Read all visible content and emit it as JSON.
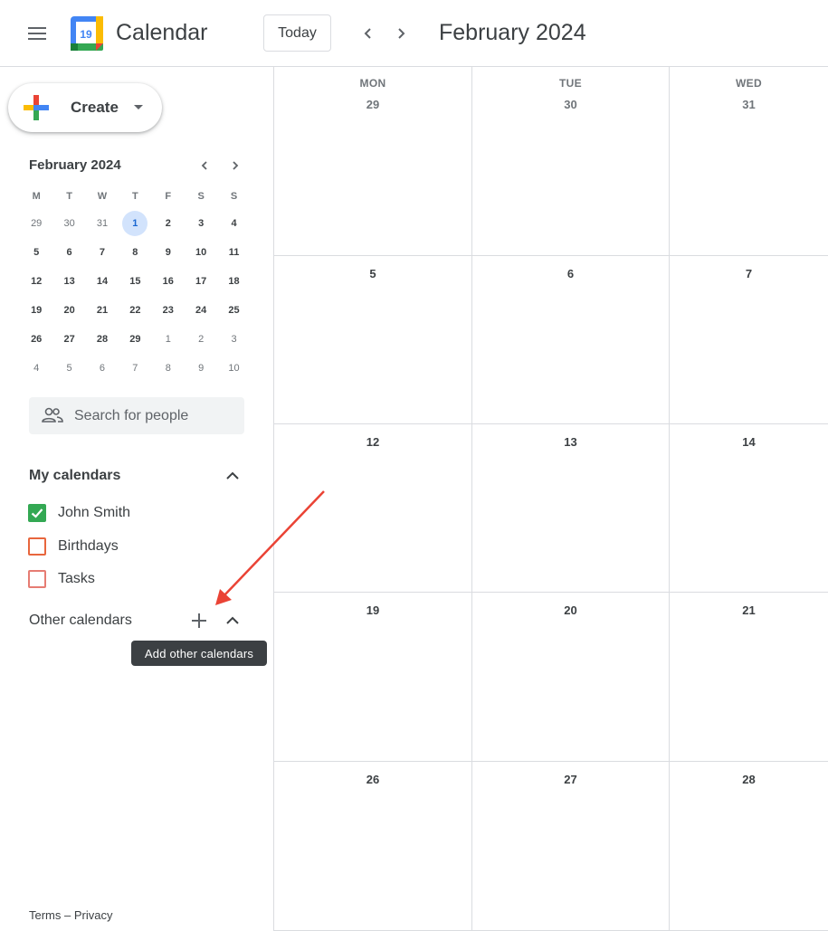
{
  "header": {
    "app_title": "Calendar",
    "logo_day": "19",
    "today_label": "Today",
    "month_title": "February 2024"
  },
  "sidebar": {
    "create_label": "Create",
    "mini_calendar": {
      "title": "February 2024",
      "weekdays": [
        "M",
        "T",
        "W",
        "T",
        "F",
        "S",
        "S"
      ],
      "weeks": [
        [
          {
            "d": "29",
            "other": true
          },
          {
            "d": "30",
            "other": true
          },
          {
            "d": "31",
            "other": true
          },
          {
            "d": "1",
            "today": true
          },
          {
            "d": "2"
          },
          {
            "d": "3"
          },
          {
            "d": "4"
          }
        ],
        [
          {
            "d": "5"
          },
          {
            "d": "6"
          },
          {
            "d": "7"
          },
          {
            "d": "8"
          },
          {
            "d": "9"
          },
          {
            "d": "10"
          },
          {
            "d": "11"
          }
        ],
        [
          {
            "d": "12"
          },
          {
            "d": "13"
          },
          {
            "d": "14"
          },
          {
            "d": "15"
          },
          {
            "d": "16"
          },
          {
            "d": "17"
          },
          {
            "d": "18"
          }
        ],
        [
          {
            "d": "19"
          },
          {
            "d": "20"
          },
          {
            "d": "21"
          },
          {
            "d": "22"
          },
          {
            "d": "23"
          },
          {
            "d": "24"
          },
          {
            "d": "25"
          }
        ],
        [
          {
            "d": "26"
          },
          {
            "d": "27"
          },
          {
            "d": "28"
          },
          {
            "d": "29"
          },
          {
            "d": "1",
            "other": true
          },
          {
            "d": "2",
            "other": true
          },
          {
            "d": "3",
            "other": true
          }
        ],
        [
          {
            "d": "4",
            "other": true
          },
          {
            "d": "5",
            "other": true
          },
          {
            "d": "6",
            "other": true
          },
          {
            "d": "7",
            "other": true
          },
          {
            "d": "8",
            "other": true
          },
          {
            "d": "9",
            "other": true
          },
          {
            "d": "10",
            "other": true
          }
        ]
      ]
    },
    "search_people_placeholder": "Search for people",
    "my_calendars_title": "My calendars",
    "my_calendars": [
      {
        "label": "John Smith",
        "checked": true,
        "color": "#33a853"
      },
      {
        "label": "Birthdays",
        "checked": false,
        "color": "#e8663d"
      },
      {
        "label": "Tasks",
        "checked": false,
        "color": "#e67c73"
      }
    ],
    "other_calendars_title": "Other calendars",
    "tooltip": "Add other calendars",
    "footer": {
      "terms": "Terms",
      "separator": "–",
      "privacy": "Privacy"
    }
  },
  "grid": {
    "weekdays": [
      "MON",
      "TUE",
      "WED"
    ],
    "weeks": [
      [
        "29",
        "30",
        "31"
      ],
      [
        "5",
        "6",
        "7"
      ],
      [
        "12",
        "13",
        "14"
      ],
      [
        "19",
        "20",
        "21"
      ],
      [
        "26",
        "27",
        "28"
      ]
    ]
  },
  "colors": {
    "accent_blue": "#1a73e8",
    "today_bg": "#d2e3fc",
    "annotation_arrow": "#ea4335"
  }
}
